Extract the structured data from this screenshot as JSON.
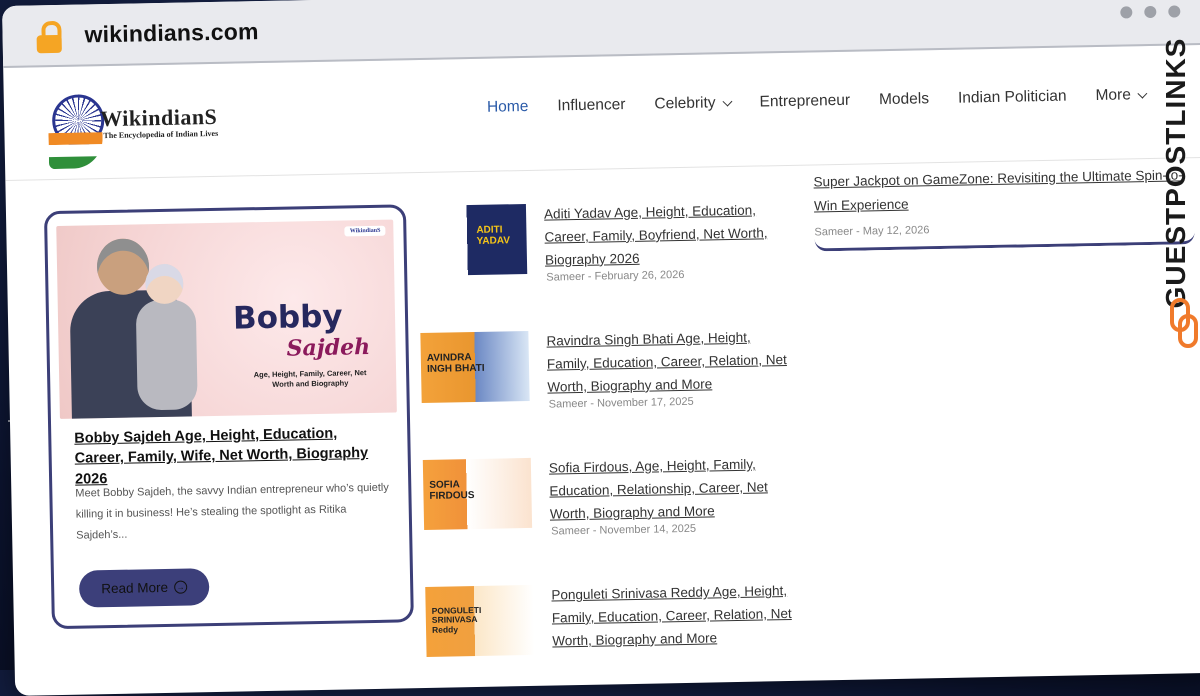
{
  "browser": {
    "url": "wikindians.com"
  },
  "header": {
    "logo_name": "WikindianS",
    "logo_tagline": "The Encyclopedia of Indian Lives",
    "nav": [
      {
        "label": "Home",
        "active": true
      },
      {
        "label": "Influencer"
      },
      {
        "label": "Celebrity",
        "has_dropdown": true
      },
      {
        "label": "Entrepreneur"
      },
      {
        "label": "Models"
      },
      {
        "label": "Indian Politician"
      },
      {
        "label": "More",
        "has_dropdown": true
      }
    ]
  },
  "featured": {
    "image_title": "Bobby",
    "image_subtitle": "Sajdeh",
    "image_caption": "Age, Height, Family, Career, Net Worth and Biography",
    "image_stamp": "WikindianS",
    "title": "Bobby Sajdeh Age, Height, Education, Career, Family, Wife, Net Worth, Biography 2026",
    "excerpt": "Meet Bobby Sajdeh, the savvy Indian entrepreneur who’s quietly killing it in business! He’s stealing the spotlight as Ritika Sajdeh’s...",
    "read_more": "Read More"
  },
  "posts": [
    {
      "thumb_label": "ADITI\nYADAV",
      "title": "Aditi Yadav Age, Height, Education, Career, Family, Boyfriend, Net Worth, Biography 2026",
      "meta": "Sameer - February 26, 2026"
    },
    {
      "thumb_label": "AVINDRA\nINGH BHATI",
      "title": "Ravindra Singh Bhati Age, Height, Family, Education, Career, Relation, Net Worth, Biography and More",
      "meta": "Sameer - November 17, 2025"
    },
    {
      "thumb_label": "SOFIA\nFIRDOUS",
      "title": "Sofia Firdous, Age, Height, Family, Education, Relationship, Career, Net Worth, Biography and More",
      "meta": "Sameer - November 14, 2025"
    },
    {
      "thumb_label": "PONGULETI\nSRINIVASA\nReddy",
      "title": "Ponguleti Srinivasa Reddy Age, Height, Family, Education, Career, Relation, Net Worth, Biography and More",
      "meta": ""
    }
  ],
  "sidebar_post": {
    "title": "Super Jackpot on GameZone: Revisiting the Ultimate Spin-to-Win Experience",
    "meta": "Sameer - May 12, 2026"
  },
  "watermark": {
    "text": "GUESTPOSTLINKS"
  },
  "colors": {
    "accent": "#3c3f78",
    "nav_active": "#2a5aa8",
    "lock": "#f5a524",
    "watermark_icon": "#f07a2b"
  }
}
